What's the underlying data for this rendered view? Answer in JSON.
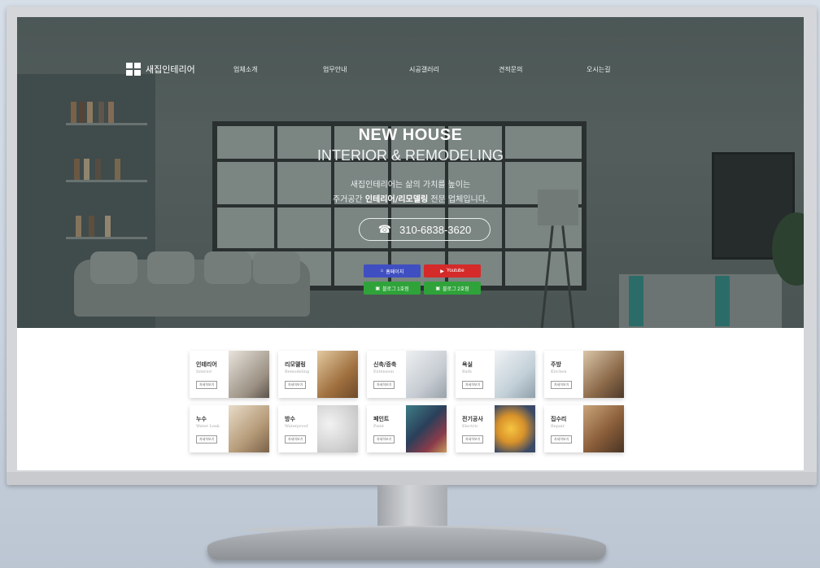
{
  "site": {
    "logo_text": "새집인테리어",
    "nav": [
      "업체소개",
      "업무안내",
      "시공갤러리",
      "견적문의",
      "오시는길"
    ]
  },
  "hero": {
    "title_line1": "NEW HOUSE",
    "title_line2": "INTERIOR & REMODELING",
    "desc_line1": "새집인테리어는 삶의 가치를 높이는",
    "desc_line2_prefix": "주거공간",
    "desc_line2_bold": "인테리어/리모델링",
    "desc_line2_suffix": "전문 업체입니다.",
    "phone": "310-6838-3620",
    "buttons": {
      "home": "홈페이지",
      "youtube": "Youtube",
      "blog1": "블로그 1호점",
      "blog2": "블로그 2호점"
    }
  },
  "cards": [
    {
      "ko": "인테리어",
      "en": "Interior",
      "more": "자세히보기"
    },
    {
      "ko": "리모델링",
      "en": "Remodeling",
      "more": "자세히보기"
    },
    {
      "ko": "신축/증축",
      "en": "Extension",
      "more": "자세히보기"
    },
    {
      "ko": "욕실",
      "en": "Bath",
      "more": "자세히보기"
    },
    {
      "ko": "주방",
      "en": "Kitchen",
      "more": "자세히보기"
    },
    {
      "ko": "누수",
      "en": "Water Leak",
      "more": "자세히보기"
    },
    {
      "ko": "방수",
      "en": "Waterproof",
      "more": "자세히보기"
    },
    {
      "ko": "페인트",
      "en": "Paint",
      "more": "자세히보기"
    },
    {
      "ko": "전기공사",
      "en": "Electric",
      "more": "자세히보기"
    },
    {
      "ko": "집수리",
      "en": "Repair",
      "more": "자세히보기"
    }
  ],
  "colors": {
    "btn_home": "#3f4fc2",
    "btn_youtube": "#d42a2a",
    "btn_blog": "#2fa33a"
  }
}
